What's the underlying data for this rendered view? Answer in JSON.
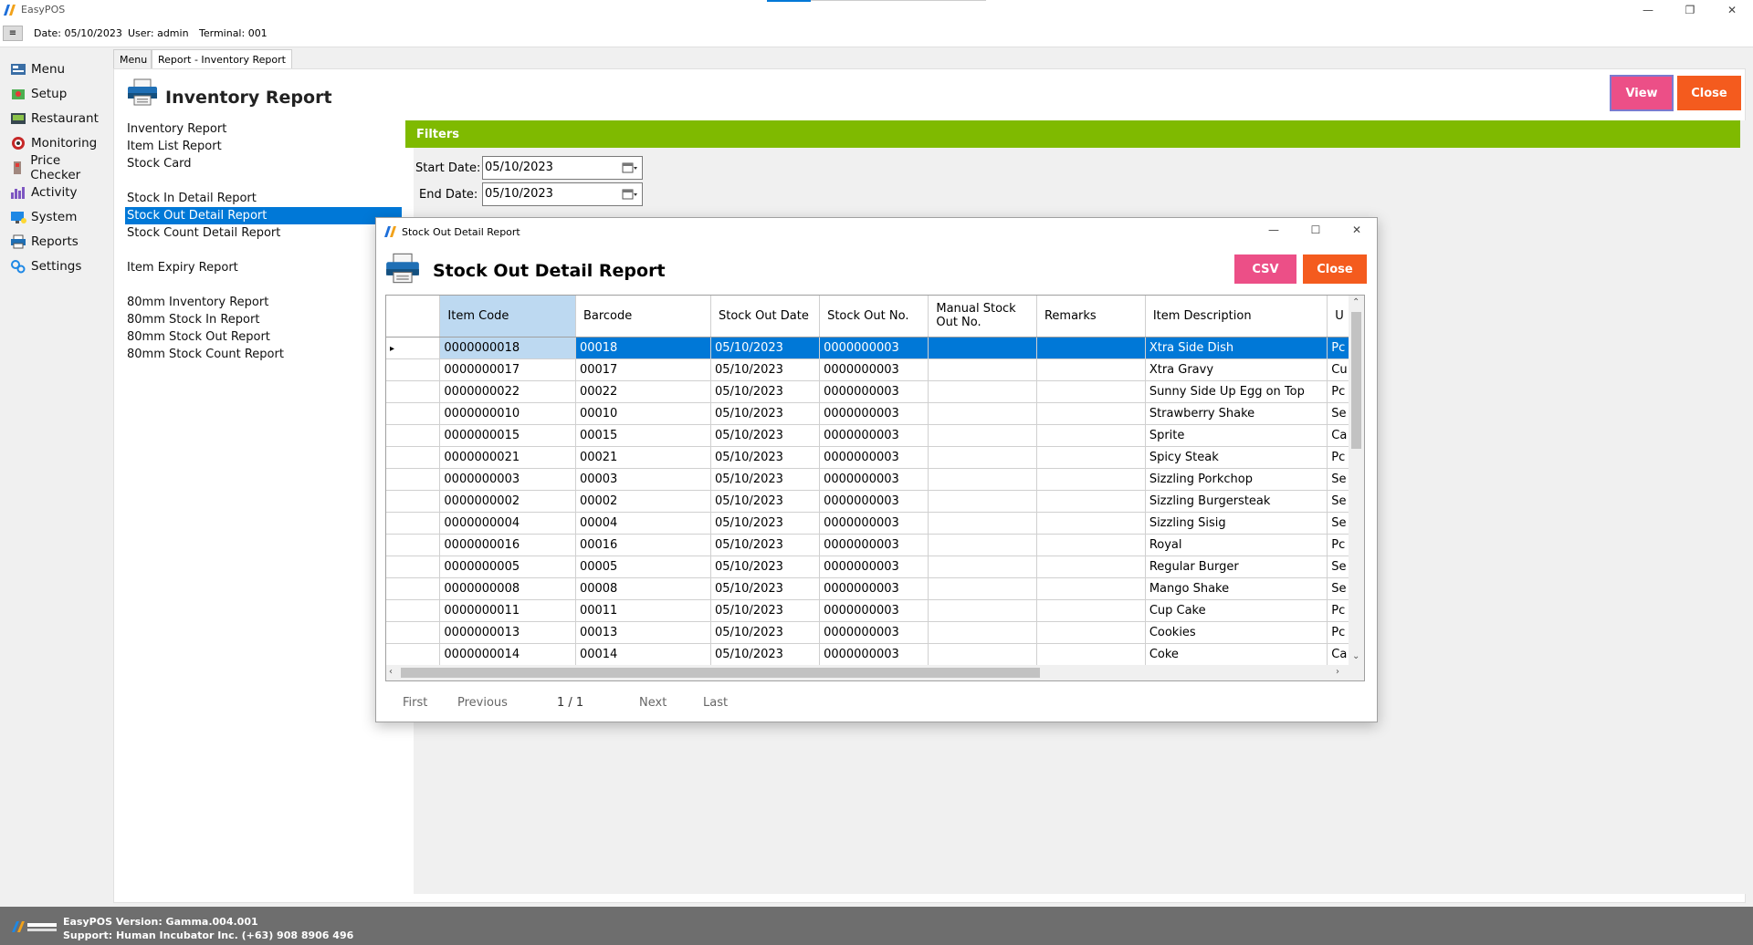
{
  "app": {
    "title": "EasyPOS"
  },
  "topbar": {
    "date": "Date: 05/10/2023",
    "user": "User: admin",
    "terminal": "Terminal: 001",
    "menu_glyph": "≡"
  },
  "nav": [
    {
      "label": "Menu",
      "icon": "menu-icon"
    },
    {
      "label": "Setup",
      "icon": "setup-icon"
    },
    {
      "label": "Restaurant",
      "icon": "restaurant-icon"
    },
    {
      "label": "Monitoring",
      "icon": "monitoring-icon"
    },
    {
      "label": "Price Checker",
      "icon": "price-checker-icon"
    },
    {
      "label": "Activity",
      "icon": "activity-icon"
    },
    {
      "label": "System",
      "icon": "system-icon"
    },
    {
      "label": "Reports",
      "icon": "reports-icon"
    },
    {
      "label": "Settings",
      "icon": "settings-icon"
    }
  ],
  "tabs": [
    "Menu",
    "Report - Inventory Report"
  ],
  "main": {
    "title": "Inventory Report",
    "view_label": "View",
    "close_label": "Close"
  },
  "reports": [
    "Inventory Report",
    "Item List Report",
    "Stock Card",
    "",
    "Stock In Detail Report",
    "Stock Out Detail Report",
    "Stock Count Detail Report",
    "",
    "Item Expiry Report",
    "",
    "80mm Inventory Report",
    "80mm Stock In Report",
    "80mm Stock Out Report",
    "80mm Stock Count Report"
  ],
  "filters": {
    "title": "Filters",
    "start_label": "Start Date:",
    "start_value": "05/10/2023",
    "end_label": "End Date:",
    "end_value": "05/10/2023"
  },
  "dialog": {
    "window_title": "Stock Out Detail Report",
    "title": "Stock Out Detail Report",
    "csv_label": "CSV",
    "close_label": "Close",
    "columns": [
      "Item Code",
      "Barcode",
      "Stock Out Date",
      "Stock Out No.",
      "Manual Stock Out No.",
      "Remarks",
      "Item Description",
      "U"
    ],
    "rows": [
      [
        "0000000018",
        "00018",
        "05/10/2023",
        "0000000003",
        "",
        "",
        "Xtra Side Dish",
        "Pc"
      ],
      [
        "0000000017",
        "00017",
        "05/10/2023",
        "0000000003",
        "",
        "",
        "Xtra Gravy",
        "Cu"
      ],
      [
        "0000000022",
        "00022",
        "05/10/2023",
        "0000000003",
        "",
        "",
        "Sunny Side Up Egg on Top",
        "Pc"
      ],
      [
        "0000000010",
        "00010",
        "05/10/2023",
        "0000000003",
        "",
        "",
        "Strawberry Shake",
        "Se"
      ],
      [
        "0000000015",
        "00015",
        "05/10/2023",
        "0000000003",
        "",
        "",
        "Sprite",
        "Ca"
      ],
      [
        "0000000021",
        "00021",
        "05/10/2023",
        "0000000003",
        "",
        "",
        "Spicy Steak",
        "Pc"
      ],
      [
        "0000000003",
        "00003",
        "05/10/2023",
        "0000000003",
        "",
        "",
        "Sizzling Porkchop",
        "Se"
      ],
      [
        "0000000002",
        "00002",
        "05/10/2023",
        "0000000003",
        "",
        "",
        "Sizzling Burgersteak",
        "Se"
      ],
      [
        "0000000004",
        "00004",
        "05/10/2023",
        "0000000003",
        "",
        "",
        "Sizzling  Sisig",
        "Se"
      ],
      [
        "0000000016",
        "00016",
        "05/10/2023",
        "0000000003",
        "",
        "",
        "Royal",
        "Pc"
      ],
      [
        "0000000005",
        "00005",
        "05/10/2023",
        "0000000003",
        "",
        "",
        "Regular Burger",
        "Se"
      ],
      [
        "0000000008",
        "00008",
        "05/10/2023",
        "0000000003",
        "",
        "",
        "Mango Shake",
        "Se"
      ],
      [
        "0000000011",
        "00011",
        "05/10/2023",
        "0000000003",
        "",
        "",
        "Cup Cake",
        "Pc"
      ],
      [
        "0000000013",
        "00013",
        "05/10/2023",
        "0000000003",
        "",
        "",
        "Cookies",
        "Pc"
      ],
      [
        "0000000014",
        "00014",
        "05/10/2023",
        "0000000003",
        "",
        "",
        "Coke",
        "Ca"
      ]
    ],
    "pager": {
      "first": "First",
      "previous": "Previous",
      "page": "1 / 1",
      "next": "Next",
      "last": "Last"
    }
  },
  "status": {
    "version": "EasyPOS Version: Gamma.004.001",
    "support": "Support: Human Incubator Inc. (+63) 908 8906 496"
  },
  "colors": {
    "accent": "#0078d7",
    "filters_green": "#7fba00",
    "view_pink": "#ec4f87",
    "close_orange": "#f45b1e"
  }
}
